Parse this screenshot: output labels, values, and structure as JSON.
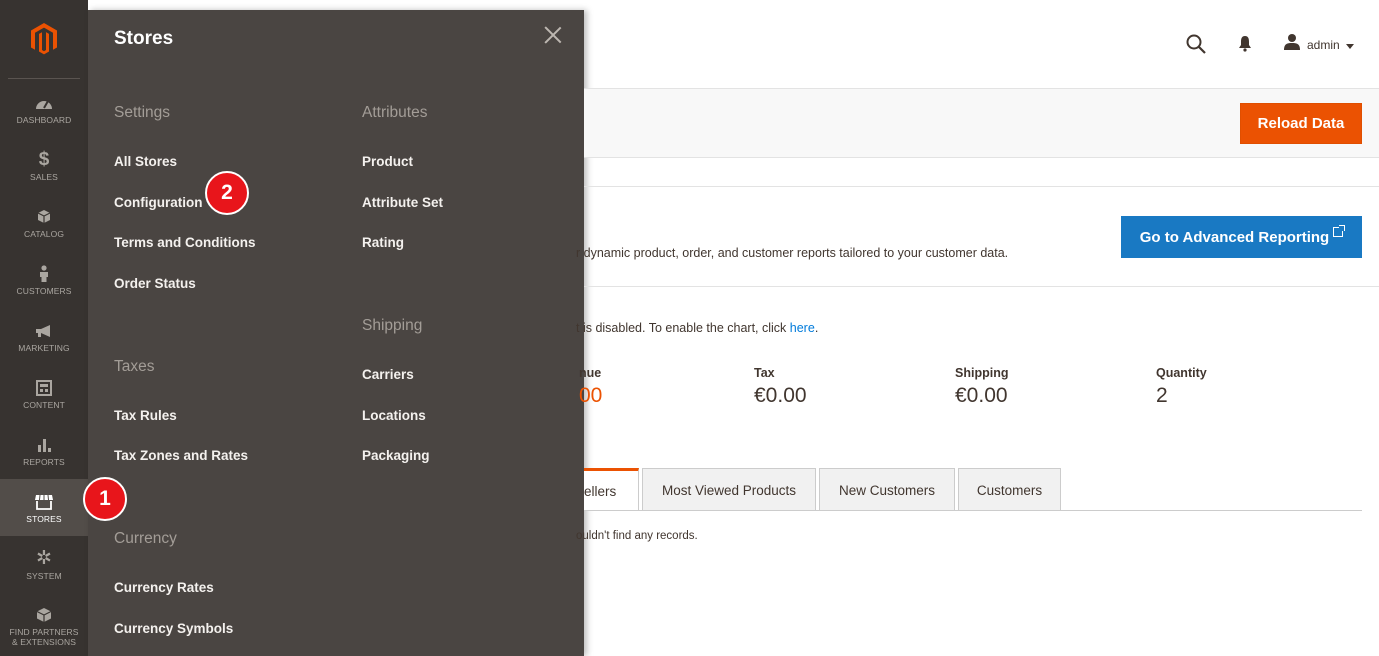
{
  "nav": {
    "items": [
      {
        "label": "DASHBOARD",
        "icon": "dashboard-icon"
      },
      {
        "label": "SALES",
        "icon": "dollar-icon"
      },
      {
        "label": "CATALOG",
        "icon": "box-icon"
      },
      {
        "label": "CUSTOMERS",
        "icon": "person-icon"
      },
      {
        "label": "MARKETING",
        "icon": "megaphone-icon"
      },
      {
        "label": "CONTENT",
        "icon": "content-icon"
      },
      {
        "label": "REPORTS",
        "icon": "bar-chart-icon"
      },
      {
        "label": "STORES",
        "icon": "storefront-icon"
      },
      {
        "label": "SYSTEM",
        "icon": "gear-icon"
      },
      {
        "label": "FIND PARTNERS & EXTENSIONS",
        "label_line1": "FIND PARTNERS",
        "label_line2": "& EXTENSIONS",
        "icon": "cube-icon"
      }
    ]
  },
  "flyout": {
    "title": "Stores",
    "settings": {
      "heading": "Settings",
      "links": [
        "All Stores",
        "Configuration",
        "Terms and Conditions",
        "Order Status"
      ]
    },
    "taxes": {
      "heading": "Taxes",
      "links": [
        "Tax Rules",
        "Tax Zones and Rates"
      ]
    },
    "currency": {
      "heading": "Currency",
      "links": [
        "Currency Rates",
        "Currency Symbols"
      ]
    },
    "attributes": {
      "heading": "Attributes",
      "links": [
        "Product",
        "Attribute Set",
        "Rating"
      ]
    },
    "shipping": {
      "heading": "Shipping",
      "links": [
        "Carriers",
        "Locations",
        "Packaging"
      ]
    }
  },
  "badges": {
    "one": "1",
    "two": "2"
  },
  "header": {
    "user": "admin"
  },
  "actions": {
    "reload": "Reload Data"
  },
  "advanced": {
    "text": "r dynamic product, order, and customer reports tailored to your customer data.",
    "button": "Go to Advanced Reporting"
  },
  "chart_note": {
    "prefix": "t is disabled. To enable the chart, click ",
    "link": "here",
    "suffix": "."
  },
  "totals": [
    {
      "label": "nue",
      "value": "00"
    },
    {
      "label": "Tax",
      "value": "€0.00"
    },
    {
      "label": "Shipping",
      "value": "€0.00"
    },
    {
      "label": "Quantity",
      "value": "2"
    }
  ],
  "tabs": [
    "ellers",
    "Most Viewed Products",
    "New Customers",
    "Customers"
  ],
  "no_records": "ouldn't find any records.",
  "colors": {
    "accent": "#eb5202",
    "primary": "#1979c3",
    "nav_bg": "#373330",
    "flyout_bg": "#4a4542",
    "badge": "#e8151b"
  }
}
